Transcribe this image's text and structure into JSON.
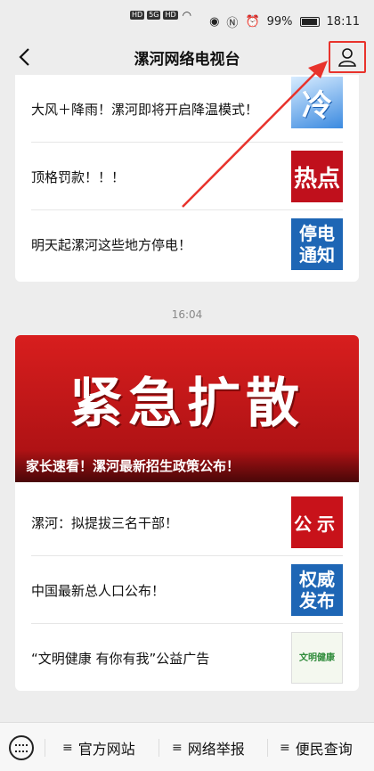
{
  "status": {
    "left_badges": [
      "HD",
      "5G",
      "HD"
    ],
    "battery": "99%",
    "time": "18:11"
  },
  "header": {
    "title": "漯河网络电视台"
  },
  "articles_group1": [
    {
      "title": "大风＋降雨！漯河即将开启降温模式！",
      "thumb_text": "冷"
    },
    {
      "title": "顶格罚款！！！",
      "thumb_text": "热点"
    },
    {
      "title": "明天起漯河这些地方停电！",
      "thumb_text": [
        "停电",
        "通知"
      ]
    }
  ],
  "timestamp": "16:04",
  "headline": {
    "banner_text": "紧急扩散",
    "caption": "家长速看！漯河最新招生政策公布！"
  },
  "articles_group2": [
    {
      "title": "漯河：拟提拔三名干部！",
      "thumb_text": "公示"
    },
    {
      "title": "中国最新总人口公布！",
      "thumb_text": [
        "权威",
        "发布"
      ]
    },
    {
      "title": "“文明健康 有你有我”公益广告",
      "thumb_text": "文明健康"
    }
  ],
  "bottom_menu": {
    "items": [
      "官方网站",
      "网络举报",
      "便民查询"
    ]
  },
  "colors": {
    "accent": "#e8332c",
    "background": "#ededed"
  }
}
